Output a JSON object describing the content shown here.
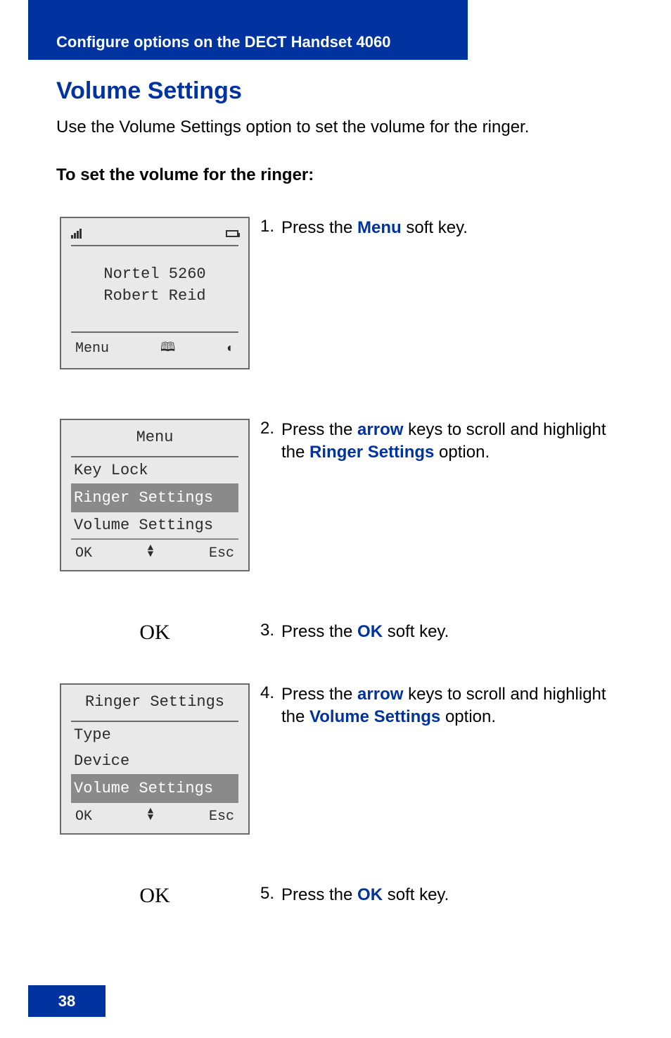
{
  "header_bar": "Configure options on the DECT Handset 4060",
  "title": "Volume Settings",
  "intro": "Use the Volume Settings option to set the volume for the ringer.",
  "subhead": "To set the volume for the ringer:",
  "page_number": "38",
  "ok_label": "OK",
  "softkeys": {
    "menu": "Menu",
    "ok": "OK",
    "esc": "Esc"
  },
  "screen1": {
    "line1": "Nortel 5260",
    "line2": "Robert Reid"
  },
  "screen2": {
    "title": "Menu",
    "items": [
      "Key Lock",
      "Ringer Settings",
      "Volume Settings"
    ],
    "selected_index": 1
  },
  "screen3": {
    "title": "Ringer Settings",
    "items": [
      "Type",
      "Device",
      "Volume Settings"
    ],
    "selected_index": 2
  },
  "steps": {
    "s1": {
      "num": "1.",
      "pre": "Press the ",
      "kw": "Menu",
      "post": " soft key."
    },
    "s2": {
      "num": "2.",
      "pre": "Press the ",
      "kw1": "arrow",
      "mid": " keys to scroll and highlight the ",
      "kw2": "Ringer Settings",
      "post": " option."
    },
    "s3": {
      "num": "3.",
      "pre": "Press the ",
      "kw": "OK",
      "post": " soft key."
    },
    "s4": {
      "num": "4.",
      "pre": "Press the ",
      "kw1": "arrow",
      "mid": " keys to scroll and highlight the ",
      "kw2": "Volume Settings",
      "post": " option."
    },
    "s5": {
      "num": "5.",
      "pre": "Press the ",
      "kw": "OK",
      "post": " soft key."
    }
  }
}
